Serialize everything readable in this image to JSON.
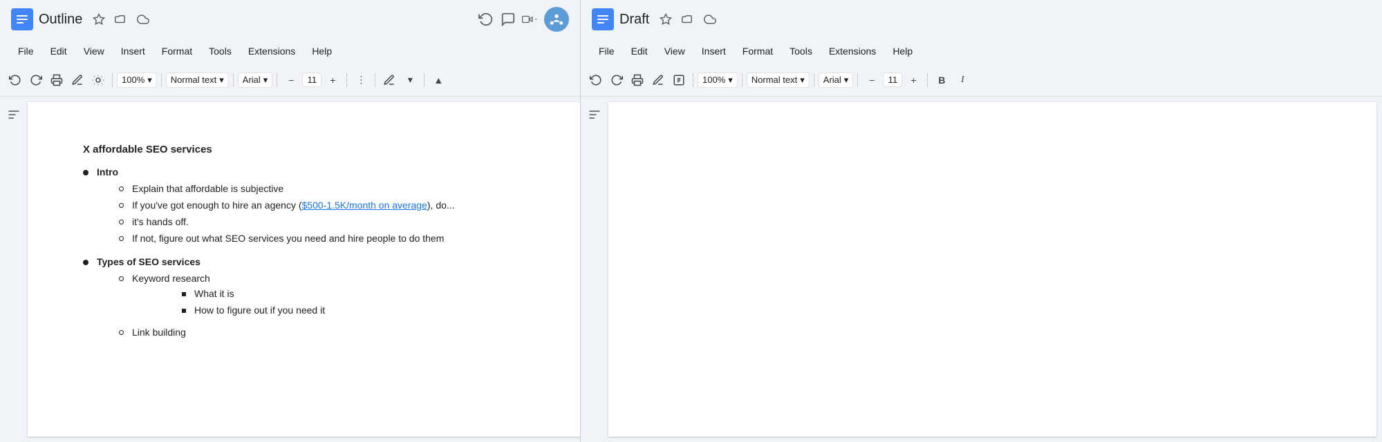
{
  "left": {
    "title": "Outline",
    "menu": [
      "File",
      "Edit",
      "View",
      "Insert",
      "Format",
      "Tools",
      "Extensions",
      "Help"
    ],
    "zoom": "100%",
    "normal_text": "Normal text",
    "font": "Arial",
    "font_size": "11",
    "content": {
      "heading": "X affordable SEO services",
      "bullets": [
        {
          "level": 1,
          "text": "Intro",
          "children": [
            {
              "level": 2,
              "text": "Explain that affordable is subjective"
            },
            {
              "level": 2,
              "text_before_link": "If you've got enough to hire an agency (",
              "link": "$500-1.5K/month on average",
              "text_after_link": "), do..."
            },
            {
              "level": 2,
              "text": "it's hands off."
            },
            {
              "level": 2,
              "text": "If not, figure out what SEO services you need and hire people to do them"
            }
          ]
        },
        {
          "level": 1,
          "text": "Types of SEO services",
          "children": [
            {
              "level": 2,
              "text": "Keyword research",
              "children": [
                {
                  "level": 3,
                  "text": "What it is"
                },
                {
                  "level": 3,
                  "text": "How to figure out if you need it"
                }
              ]
            },
            {
              "level": 2,
              "text": "Link building"
            }
          ]
        }
      ]
    }
  },
  "right": {
    "title": "Draft",
    "menu": [
      "File",
      "Edit",
      "View",
      "Insert",
      "Format",
      "Tools",
      "Extensions",
      "Help"
    ],
    "zoom": "100%",
    "normal_text": "Normal text",
    "font": "Arial",
    "font_size": "11"
  },
  "icons": {
    "undo": "↩",
    "redo": "↪",
    "print": "🖨",
    "spellcheck": "✓",
    "paintformat": "🖌",
    "star": "☆",
    "folder": "📁",
    "cloud": "☁",
    "history": "🕐",
    "comment": "💬",
    "videocall": "📹",
    "menu_lines": "☰",
    "chevron_down": "▾",
    "minus": "−",
    "plus": "+",
    "more_vert": "⋮",
    "pen": "✏",
    "bold": "B"
  }
}
